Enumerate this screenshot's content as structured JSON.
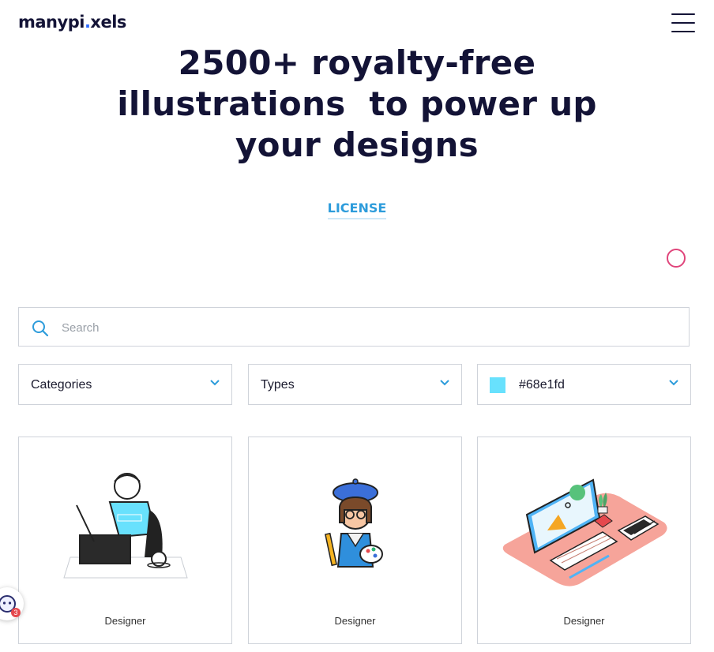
{
  "header": {
    "logo_text_1": "manypi",
    "logo_dot": ".",
    "logo_text_2": "xels",
    "menu_icon": "hamburger-menu-icon"
  },
  "hero": {
    "line1": "2500+ royalty-free",
    "line2": "illustrations  to power up",
    "line3": "your designs"
  },
  "license_link": "LICENSE",
  "search": {
    "placeholder": "Search",
    "value": "",
    "icon": "search-icon"
  },
  "filters": {
    "categories": "Categories",
    "types": "Types",
    "color_value": "#68e1fd",
    "swatch_color": "#68e1fd"
  },
  "cards": [
    {
      "caption": "Designer",
      "icon": "designer-at-tablet-illustration"
    },
    {
      "caption": "Designer",
      "icon": "painter-with-beret-illustration"
    },
    {
      "caption": "Designer",
      "icon": "isometric-workspace-illustration"
    }
  ],
  "chat_widget": {
    "badge": "3",
    "icon": "chat-bot-icon"
  },
  "colors": {
    "accent": "#2d9cdb",
    "brand_dot": "#2d6bff",
    "ring": "#e0457b",
    "text": "#131336"
  }
}
